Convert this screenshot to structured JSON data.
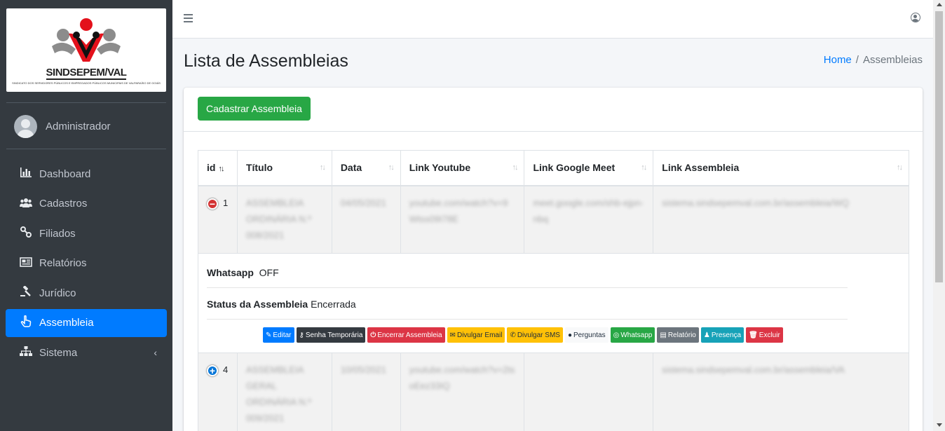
{
  "brand": {
    "name": "SINDSEPEM/VAL",
    "subtitle": "SINDICATO DOS SERVIDORES PÚBLICOS E EMPREGADOS PÚBLICOS MUNICIPAIS DE VALPARAÍSO DE GOIÁS"
  },
  "sidebar": {
    "user": "Administrador",
    "items": [
      {
        "label": "Dashboard",
        "icon": "chart-bar-icon"
      },
      {
        "label": "Cadastros",
        "icon": "users-icon"
      },
      {
        "label": "Filiados",
        "icon": "link-icon"
      },
      {
        "label": "Relatórios",
        "icon": "newspaper-icon"
      },
      {
        "label": "Jurídico",
        "icon": "gavel-icon"
      },
      {
        "label": "Assembleia",
        "icon": "hand-pointer-icon",
        "active": true
      },
      {
        "label": "Sistema",
        "icon": "sitemap-icon",
        "has_children": true
      }
    ]
  },
  "header": {
    "title": "Lista de Assembleias",
    "breadcrumb": {
      "home": "Home",
      "separator": "/",
      "current": "Assembleias"
    }
  },
  "card": {
    "create_button": "Cadastrar Assembleia"
  },
  "table": {
    "columns": [
      "id",
      "Título",
      "Data",
      "Link Youtube",
      "Link Google Meet",
      "Link Assembleia"
    ],
    "rows": [
      {
        "id": "1",
        "titulo": "ASSEMBLEIA ORDINÁRIA N.º 008/2021",
        "data": "04/05/2021",
        "youtube": "youtube.com/watch?v=9Wtss09I78E",
        "meet": "meet.google.com/shb-ejpn-nbq",
        "assembleia": "sistema.sindsepemval.com.br/assembleia/WQ",
        "expanded": true
      },
      {
        "id": "4",
        "titulo": "ASSEMBLEIA GERAL ORDINÁRIA N.º 009/2021",
        "data": "10/05/2021",
        "youtube": "youtube.com/watch?v=2tsoEez33IQ",
        "meet": "",
        "assembleia": "sistema.sindsepemval.com.br/assembleia/VA",
        "expanded": false
      }
    ],
    "child": {
      "whatsapp_label": "Whatsapp",
      "whatsapp_value": "OFF",
      "status_label": "Status da Assembleia",
      "status_value": "Encerrada"
    },
    "actions": [
      {
        "label": "Editar",
        "icon": "pencil-icon",
        "glyph": "✎"
      },
      {
        "label": "Senha Temporária",
        "icon": "key-icon",
        "glyph": "⚷"
      },
      {
        "label": "Encerrar Assembleia",
        "icon": "power-icon",
        "glyph": "⏻"
      },
      {
        "label": "Divulgar Email",
        "icon": "envelope-icon",
        "glyph": "✉"
      },
      {
        "label": "Divulgar SMS",
        "icon": "phone-icon",
        "glyph": "✆"
      },
      {
        "label": "Perguntas",
        "icon": "comment-icon",
        "glyph": "●"
      },
      {
        "label": "Whatsapp",
        "icon": "whatsapp-icon",
        "glyph": "◎"
      },
      {
        "label": "Relatório",
        "icon": "newspaper-icon",
        "glyph": "▤"
      },
      {
        "label": "Presença",
        "icon": "user-icon",
        "glyph": "♟"
      },
      {
        "label": "Excluir",
        "icon": "trash-icon",
        "glyph": "🗑"
      }
    ]
  },
  "colors": {
    "sidebar_bg": "#343a40",
    "primary": "#007bff",
    "success": "#28a745",
    "danger": "#dc3545",
    "warning": "#ffc107"
  }
}
